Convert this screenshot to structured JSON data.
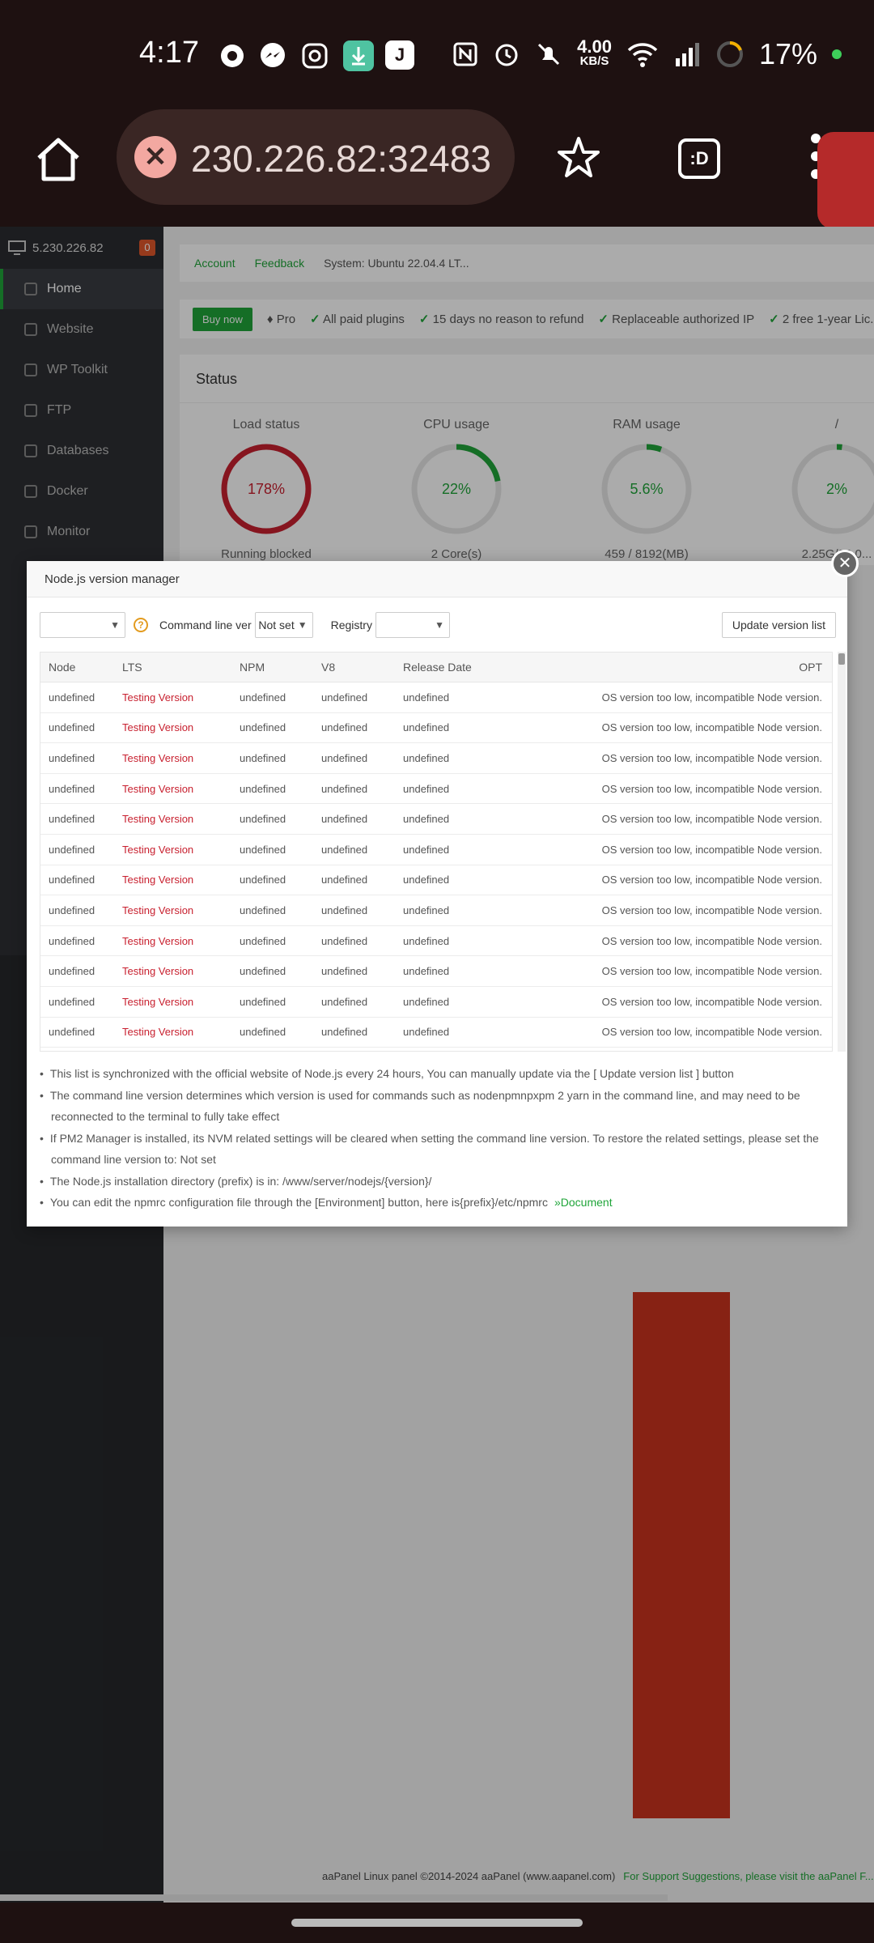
{
  "status_bar": {
    "time": "4:17",
    "net_speed_value": "4.00",
    "net_speed_unit": "KB/S",
    "battery": "17%",
    "app_j": "J",
    "icons": [
      "threads-icon",
      "messenger-icon",
      "instagram-icon",
      "download-icon",
      "j-app-icon",
      "nfc-icon",
      "alarm-icon",
      "mute-icon",
      "wifi-icon",
      "signal-icon",
      "battery-icon"
    ]
  },
  "browser": {
    "url": "230.226.82:32483",
    "tab_label": ":D"
  },
  "sidebar": {
    "host": "5.230.226.82",
    "badge": "0",
    "items": [
      {
        "label": "Home"
      },
      {
        "label": "Website"
      },
      {
        "label": "WP Toolkit"
      },
      {
        "label": "FTP"
      },
      {
        "label": "Databases"
      },
      {
        "label": "Docker"
      },
      {
        "label": "Monitor"
      }
    ]
  },
  "topbar": {
    "account": "Account",
    "feedback": "Feedback",
    "system": "System: Ubuntu 22.04.4 LT..."
  },
  "promo": {
    "buy_now": "Buy now",
    "pro": "Pro",
    "items": [
      "All paid plugins",
      "15 days no reason to refund",
      "Replaceable authorized IP",
      "2 free 1-year Lic..."
    ]
  },
  "status": {
    "title": "Status",
    "gauges": [
      {
        "title": "Load status",
        "value": "178%",
        "fraction": 1.0,
        "sub": "Running blocked",
        "color": "#c8202f"
      },
      {
        "title": "CPU usage",
        "value": "22%",
        "fraction": 0.22,
        "sub": "2 Core(s)",
        "color": "#20a53a"
      },
      {
        "title": "RAM usage",
        "value": "5.6%",
        "fraction": 0.056,
        "sub": "459 / 8192(MB)",
        "color": "#20a53a"
      },
      {
        "title": "/",
        "value": "2%",
        "fraction": 0.02,
        "sub": "2.25G/38.0...",
        "color": "#20a53a"
      }
    ]
  },
  "modal": {
    "title": "Node.js version manager",
    "cmd_label": "Command line ver",
    "cmd_value": "Not set",
    "registry_label": "Registry",
    "update_button": "Update version list",
    "columns": [
      "Node",
      "LTS",
      "NPM",
      "V8",
      "Release Date",
      "OPT"
    ],
    "rows": [
      {
        "node": "undefined",
        "lts": "Testing Version",
        "npm": "undefined",
        "v8": "undefined",
        "date": "undefined",
        "opt": "OS version too low, incompatible Node version."
      },
      {
        "node": "undefined",
        "lts": "Testing Version",
        "npm": "undefined",
        "v8": "undefined",
        "date": "undefined",
        "opt": "OS version too low, incompatible Node version."
      },
      {
        "node": "undefined",
        "lts": "Testing Version",
        "npm": "undefined",
        "v8": "undefined",
        "date": "undefined",
        "opt": "OS version too low, incompatible Node version."
      },
      {
        "node": "undefined",
        "lts": "Testing Version",
        "npm": "undefined",
        "v8": "undefined",
        "date": "undefined",
        "opt": "OS version too low, incompatible Node version."
      },
      {
        "node": "undefined",
        "lts": "Testing Version",
        "npm": "undefined",
        "v8": "undefined",
        "date": "undefined",
        "opt": "OS version too low, incompatible Node version."
      },
      {
        "node": "undefined",
        "lts": "Testing Version",
        "npm": "undefined",
        "v8": "undefined",
        "date": "undefined",
        "opt": "OS version too low, incompatible Node version."
      },
      {
        "node": "undefined",
        "lts": "Testing Version",
        "npm": "undefined",
        "v8": "undefined",
        "date": "undefined",
        "opt": "OS version too low, incompatible Node version."
      },
      {
        "node": "undefined",
        "lts": "Testing Version",
        "npm": "undefined",
        "v8": "undefined",
        "date": "undefined",
        "opt": "OS version too low, incompatible Node version."
      },
      {
        "node": "undefined",
        "lts": "Testing Version",
        "npm": "undefined",
        "v8": "undefined",
        "date": "undefined",
        "opt": "OS version too low, incompatible Node version."
      },
      {
        "node": "undefined",
        "lts": "Testing Version",
        "npm": "undefined",
        "v8": "undefined",
        "date": "undefined",
        "opt": "OS version too low, incompatible Node version."
      },
      {
        "node": "undefined",
        "lts": "Testing Version",
        "npm": "undefined",
        "v8": "undefined",
        "date": "undefined",
        "opt": "OS version too low, incompatible Node version."
      },
      {
        "node": "undefined",
        "lts": "Testing Version",
        "npm": "undefined",
        "v8": "undefined",
        "date": "undefined",
        "opt": "OS version too low, incompatible Node version."
      }
    ],
    "notes": [
      "This list is synchronized with the official website of Node.js every 24 hours, You can manually update via the [ Update version list ] button",
      "The command line version determines which version is used for commands such as nodenpmnpxpm 2 yarn in the command line, and may need to be reconnected to the terminal to fully take effect",
      "If PM2 Manager is installed, its NVM related settings will be cleared when setting the command line version. To restore the related settings, please set the command line version to: Not set",
      "The Node.js installation directory (prefix) is in: /www/server/nodejs/{version}/",
      "You can edit the npmrc configuration file through the [Environment] button, here is{prefix}/etc/npmrc"
    ],
    "doc_link": "»Document"
  },
  "footer": {
    "copyright": "aaPanel Linux panel ©2014-2024 aaPanel (www.aapanel.com)",
    "support": "For Support Suggestions, please visit the aaPanel F..."
  }
}
